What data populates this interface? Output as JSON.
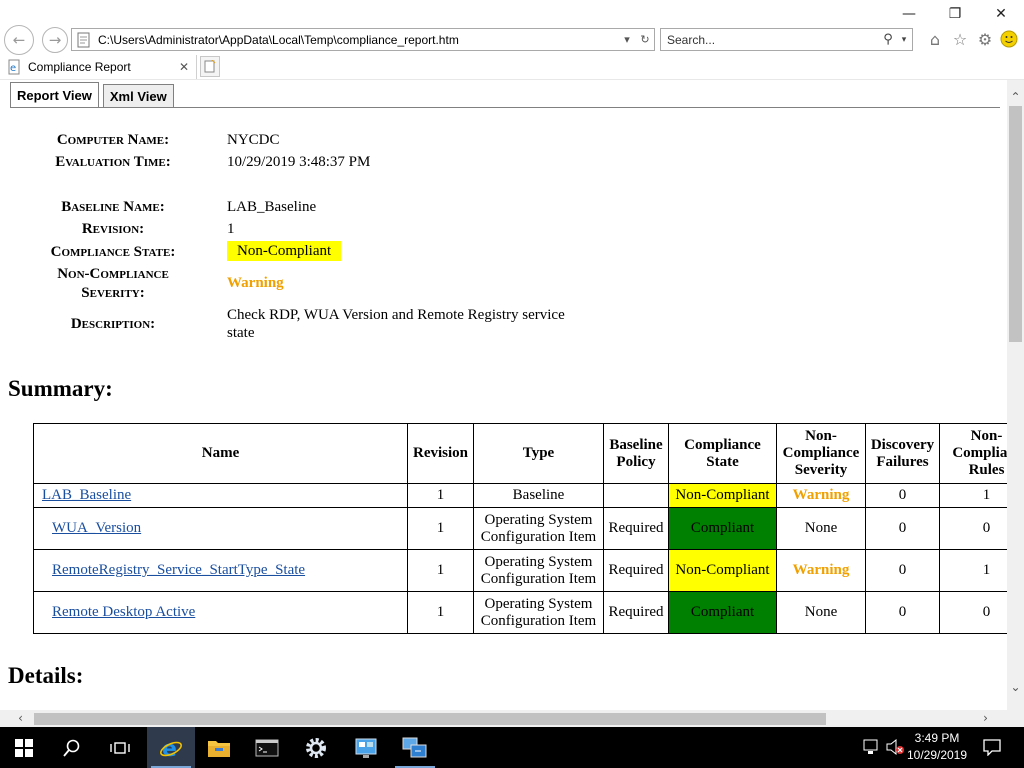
{
  "browser": {
    "url": "C:\\Users\\Administrator\\AppData\\Local\\Temp\\compliance_report.htm",
    "search_placeholder": "Search...",
    "tab_title": "Compliance Report"
  },
  "report": {
    "tabs": [
      "Report View",
      "Xml View"
    ],
    "computer_name_label": "Computer Name:",
    "computer_name": "NYCDC",
    "evaluation_time_label": "Evaluation Time:",
    "evaluation_time": "10/29/2019 3:48:37 PM",
    "baseline_name_label": "Baseline Name:",
    "baseline_name": "LAB_Baseline",
    "revision_label": "Revision:",
    "revision": "1",
    "compliance_state_label": "Compliance State:",
    "compliance_state": "Non-Compliant",
    "severity_label_1": "Non-Compliance",
    "severity_label_2": "Severity:",
    "severity": "Warning",
    "description_label": "Description:",
    "description_1": "Check RDP, WUA Version and Remote Registry service",
    "description_2": "state",
    "summary_heading": "Summary:",
    "details_heading": "Details:"
  },
  "summary": {
    "headers": {
      "name": "Name",
      "revision": "Revision",
      "type": "Type",
      "baseline_policy_1": "Baseline",
      "baseline_policy_2": "Policy",
      "compliance_1": "Compliance",
      "compliance_2": "State",
      "severity_1": "Non-",
      "severity_2": "Compliance",
      "severity_3": "Severity",
      "discovery_1": "Discovery",
      "discovery_2": "Failures",
      "ncrules_1": "Non-",
      "ncrules_2": "Compliant",
      "ncrules_3": "Rules"
    },
    "rows": [
      {
        "name": "LAB_Baseline",
        "revision": "1",
        "type_1": "Baseline",
        "type_2": "",
        "policy": "",
        "state": "Non-Compliant",
        "severity": "Warning",
        "discovery": "0",
        "rules": "1"
      },
      {
        "name": "WUA_Version",
        "revision": "1",
        "type_1": "Operating System",
        "type_2": "Configuration Item",
        "policy": "Required",
        "state": "Compliant",
        "severity": "None",
        "discovery": "0",
        "rules": "0"
      },
      {
        "name": "RemoteRegistry_Service_StartType_State",
        "revision": "1",
        "type_1": "Operating System",
        "type_2": "Configuration Item",
        "policy": "Required",
        "state": "Non-Compliant",
        "severity": "Warning",
        "discovery": "0",
        "rules": "1"
      },
      {
        "name": "Remote Desktop Active",
        "revision": "1",
        "type_1": "Operating System",
        "type_2": "Configuration Item",
        "policy": "Required",
        "state": "Compliant",
        "severity": "None",
        "discovery": "0",
        "rules": "0"
      }
    ]
  },
  "taskbar": {
    "time": "3:49 PM",
    "date": "10/29/2019"
  },
  "colors": {
    "non_compliant": "#ffff00",
    "compliant": "#008000",
    "warning": "#f0a100",
    "link": "#1a4e9f"
  }
}
